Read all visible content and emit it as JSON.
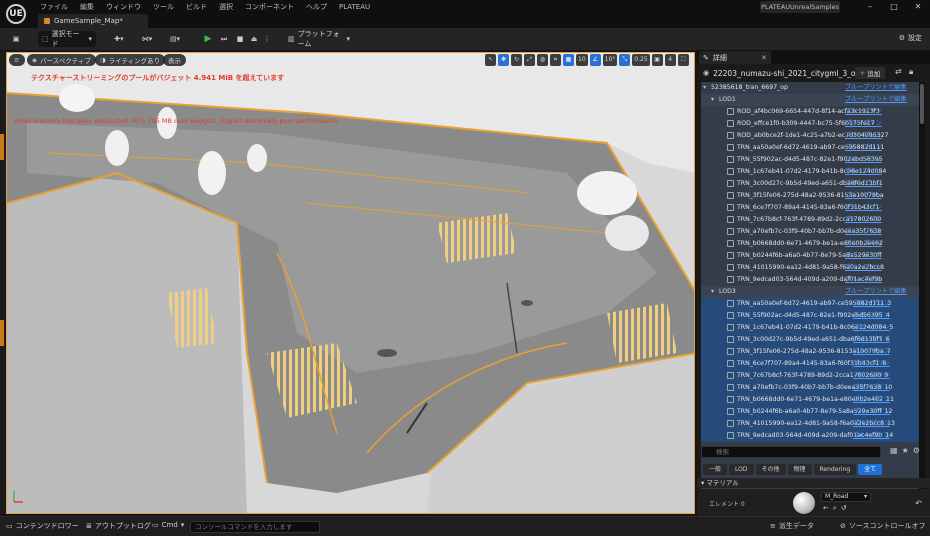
{
  "app": {
    "logo": "UE",
    "menu": [
      "ファイル",
      "編集",
      "ウィンドウ",
      "ツール",
      "ビルド",
      "選択",
      "コンポーネント",
      "ヘルプ",
      "PLATEAU"
    ],
    "map_tab": "GameSample_Map*",
    "project": "PLATEAUUnrealSamples",
    "window_controls": [
      "–",
      "□",
      "✕"
    ]
  },
  "toolbar": {
    "select_mode": "選択モード",
    "platform": "プラットフォーム",
    "settings": "設定",
    "play_icon": "play-icon"
  },
  "viewport": {
    "perspective": "パースペクティブ",
    "lighting": "ライティングあり",
    "show": "表示",
    "snap_values": [
      "10",
      "10°",
      "0.25",
      "4"
    ],
    "warning_jp": "テクスチャーストリーミングのプールがバジェット 4.941 MiB を超えています",
    "warning_en": "Video memory has been exhausted (675.795 MB over budget). Expect extremely poor performance.",
    "accent": "#e0a040"
  },
  "bottom": {
    "content_drawer": "コンテンツドロワー",
    "output_log": "アウトプットログ",
    "cmd": "Cmd",
    "console_placeholder": "コンソールコマンドを入力します",
    "derived_data": "派生データ",
    "source_control": "ソースコントロールオフ"
  },
  "details": {
    "tab": "詳細",
    "actor": "22203_numazu-shi_2021_citygml_3_op",
    "add": "追加",
    "blueprint_label": "ブループリントで編集",
    "rows": [
      {
        "text": "52385618_tran_6697_op",
        "type": "head",
        "bp": "ブループリントで編集"
      },
      {
        "text": "LOD1",
        "type": "group",
        "bp": "ブループリントで編集"
      },
      {
        "text": "ROD_af4bc069-6654-447d-8f14-acfa3c1913f3",
        "type": "item",
        "bp": "ブループリン"
      },
      {
        "text": "ROD_effce1f0-b309-4447-bc75-5f6b175fe17",
        "type": "item",
        "bp": "ブループリン"
      },
      {
        "text": "ROD_ab0bce2f-1de1-4c25-a7b2-ec7d304096327",
        "type": "item",
        "bp": "ブループリン"
      },
      {
        "text": "TRN_aa50a0ef-6d72-4619-ab97-ce595882d111",
        "type": "item",
        "bp": "ブループリン"
      },
      {
        "text": "TRN_55f902ac-d4d5-487c-82e1-f902ebd56395",
        "type": "item",
        "bp": "ブループリン"
      },
      {
        "text": "TRN_1c67eb41-07d2-4179-b41b-8c06e124d084",
        "type": "item",
        "bp": "ブループリン"
      },
      {
        "text": "TRN_3c00d27c-9b5d-49ed-a651-dba6f6d13bf1",
        "type": "item",
        "bp": "ブループリン"
      },
      {
        "text": "TRN_3f15fe06-275d-48a2-9536-8153a10079ba",
        "type": "item",
        "bp": "ブループリン"
      },
      {
        "text": "TRN_6ce7f707-89a4-4145-83a6-f60f31b43cf1",
        "type": "item",
        "bp": "ブループリン"
      },
      {
        "text": "TRN_7c67b8cf-763f-4789-89d2-2cca17802600",
        "type": "item",
        "bp": "ブループリン"
      },
      {
        "text": "TRN_a70efb7c-03f9-40b7-bb7b-d0eea35f7638",
        "type": "item",
        "bp": "ブループリン"
      },
      {
        "text": "TRN_b0668dd0-6e71-4679-be1a-e80e0b2e462",
        "type": "item",
        "bp": "ブループリン"
      },
      {
        "text": "TRN_b0244f6b-a6a0-4b77-8e79-5a8a529e30ff",
        "type": "item",
        "bp": "ブループリン"
      },
      {
        "text": "TRN_41015990-ea12-4d81-9a58-f6a0a2e2bcc8",
        "type": "item",
        "bp": "ブループリン"
      },
      {
        "text": "TRN_9edcad03-564d-409d-a209-daf01ac4ef9b",
        "type": "item",
        "bp": "ブループリン"
      },
      {
        "text": "LOD3",
        "type": "group",
        "bp": "ブループリントで編集"
      },
      {
        "text": "TRN_aa50a0ef-6d72-4619-ab97-ce595882d111_3",
        "type": "sel",
        "bp": "ブループリン"
      },
      {
        "text": "TRN_55f902ac-d4d5-487c-82e1-f902ebd56395_4",
        "type": "sel",
        "bp": "ブループリン"
      },
      {
        "text": "TRN_1c67eb41-07d2-4179-b41b-8c06e124d084_5",
        "type": "sel",
        "bp": "ブループリン"
      },
      {
        "text": "TRN_3c00d27c-9b5d-49ed-a651-dba6f6d13bf1_6",
        "type": "sel",
        "bp": "ブループリン"
      },
      {
        "text": "TRN_3f15fe06-275d-48a2-9536-8153a10079ba_7",
        "type": "sel",
        "bp": "ブループリン"
      },
      {
        "text": "TRN_6ce7f707-89a4-4145-83a6-f60f31b43cf1_8",
        "type": "sel",
        "bp": "ブループリン"
      },
      {
        "text": "TRN_7c67b8cf-763f-4789-89d2-2cca17802600_9",
        "type": "sel",
        "bp": "ブループリン"
      },
      {
        "text": "TRN_a70efb7c-03f9-40b7-bb7b-d0eea35f7638_10",
        "type": "sel",
        "bp": "ブループリン"
      },
      {
        "text": "TRN_b0668dd0-6e71-4679-be1a-e80e0b2e462_11",
        "type": "sel",
        "bp": "ブループリン"
      },
      {
        "text": "TRN_b0244f6b-a6a0-4b77-8e79-5a8a529e30ff_12",
        "type": "sel",
        "bp": "ブループリン"
      },
      {
        "text": "TRN_41015990-ea12-4d81-9a58-f6a0a2e2bcc8_13",
        "type": "sel",
        "bp": "ブループリン"
      },
      {
        "text": "TRN_9edcad03-564d-409d-a209-daf01ac4ef9b_14",
        "type": "sel",
        "bp": "ブループリン"
      }
    ],
    "search_placeholder": "検索",
    "filters": [
      "一般",
      "LOD",
      "その他",
      "物理",
      "Rendering",
      "全て"
    ],
    "active_filter": "全て",
    "material_header": "マテリアル",
    "element_label": "エレメント 0",
    "material_name": "M_Road"
  }
}
